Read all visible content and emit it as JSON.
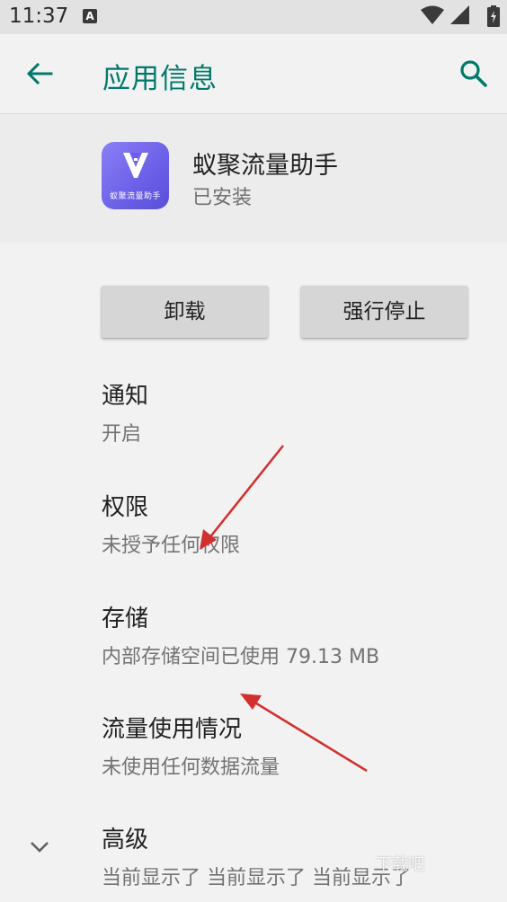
{
  "status_bar": {
    "time": "11:37",
    "badge": "A"
  },
  "app_bar": {
    "title": "应用信息",
    "back_icon": "arrow-back-icon",
    "search_icon": "search-icon",
    "accent_color": "#00796b"
  },
  "app": {
    "name": "蚁聚流量助手",
    "status": "已安装",
    "icon_text": "蚁聚流量助手",
    "icon_color": "#7a6ef0"
  },
  "buttons": {
    "uninstall": "卸载",
    "force_stop": "强行停止"
  },
  "prefs": [
    {
      "title": "通知",
      "summary": "开启"
    },
    {
      "title": "权限",
      "summary": "未授予任何权限"
    },
    {
      "title": "存储",
      "summary": "内部存储空间已使用 79.13 MB"
    },
    {
      "title": "流量使用情况",
      "summary": "未使用任何数据流量"
    },
    {
      "title": "高级",
      "summary": "当前显示了 当前显示了 当前显示了"
    }
  ],
  "watermark": "下载吧",
  "annotation_color": "#d32f2f"
}
